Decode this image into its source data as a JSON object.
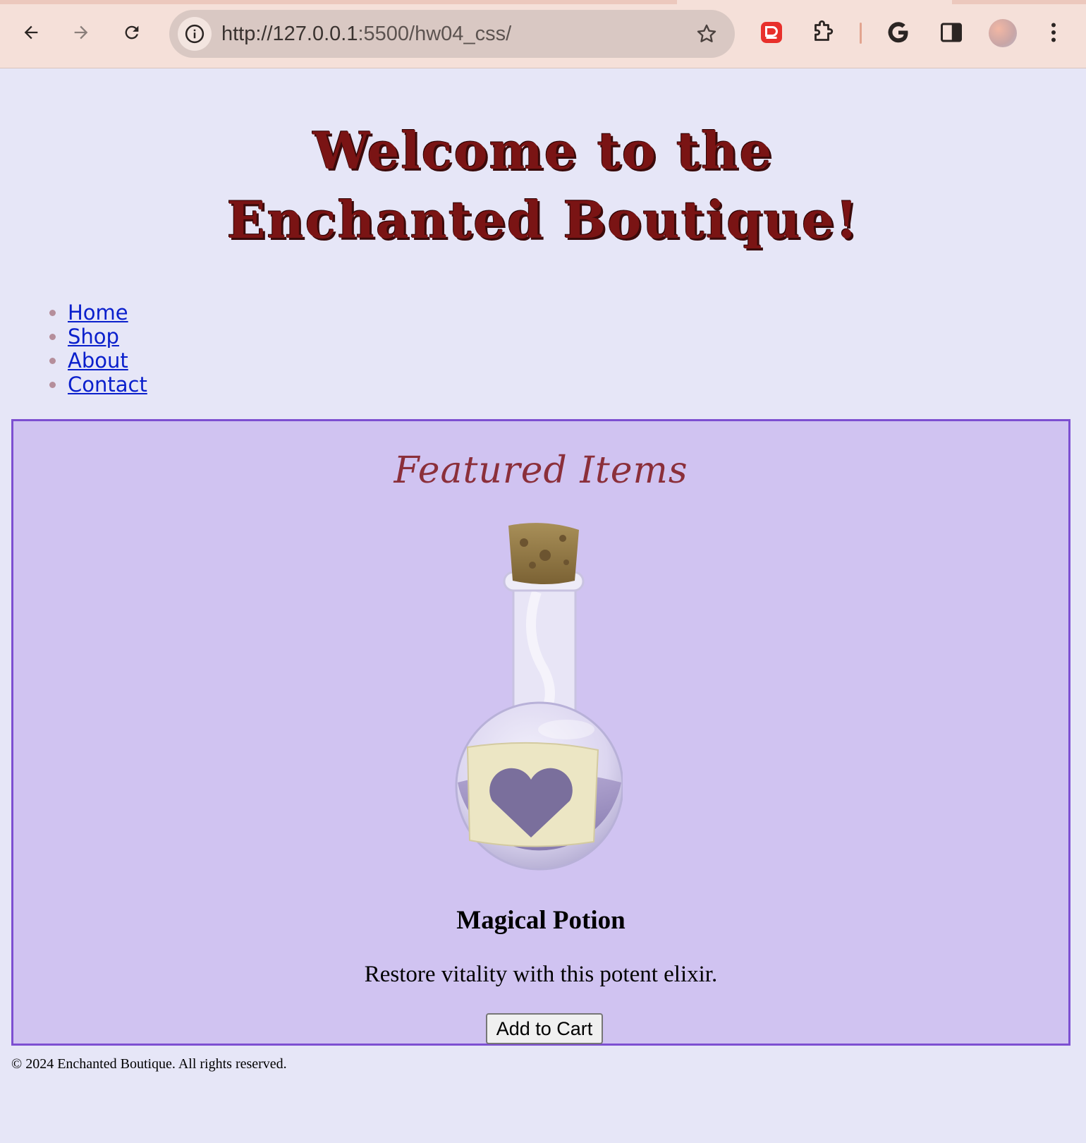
{
  "browser": {
    "url_host": "http://127.0.0.1",
    "url_path": ":5500/hw04_css/",
    "icons": [
      "back-arrow-icon",
      "forward-arrow-icon",
      "reload-icon",
      "info-icon",
      "star-icon",
      "pdf-extension-icon",
      "puzzle-extension-icon",
      "google-icon",
      "side-panel-icon",
      "profile-avatar",
      "more-vert-icon"
    ]
  },
  "header": {
    "title_line1": "Welcome to the",
    "title_line2": "Enchanted Boutique!"
  },
  "nav": {
    "items": [
      {
        "label": "Home"
      },
      {
        "label": "Shop"
      },
      {
        "label": "About"
      },
      {
        "label": "Contact"
      }
    ]
  },
  "featured": {
    "heading": "Featured Items",
    "item": {
      "name": "Magical Potion",
      "description": "Restore vitality with this potent elixir.",
      "button_label": "Add to Cart",
      "image_icon": "potion-bottle-icon"
    }
  },
  "footer": {
    "text": "© 2024 Enchanted Boutique. All rights reserved."
  },
  "colors": {
    "page_bg": "#e6e6f7",
    "featured_bg": "#d0c3f1",
    "featured_border": "#7d4fd1",
    "title_color": "#7a1414",
    "featured_heading": "#8b2f3a",
    "link": "#0a1fcc"
  }
}
